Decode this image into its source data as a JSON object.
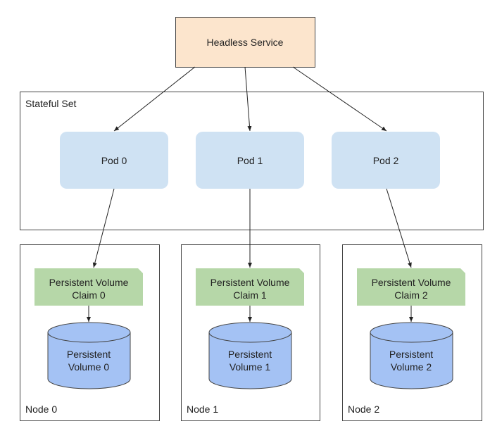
{
  "service": {
    "label": "Headless Service",
    "color": "#fce5cd"
  },
  "statefulset": {
    "label": "Stateful Set"
  },
  "pods": [
    {
      "label": "Pod 0"
    },
    {
      "label": "Pod 1"
    },
    {
      "label": "Pod 2"
    }
  ],
  "nodes": [
    {
      "label": "Node 0",
      "pvc_line1": "Persistent Volume",
      "pvc_line2": "Claim 0",
      "pv_line1": "Persistent",
      "pv_line2": "Volume 0"
    },
    {
      "label": "Node 1",
      "pvc_line1": "Persistent Volume",
      "pvc_line2": "Claim 1",
      "pv_line1": "Persistent",
      "pv_line2": "Volume 1"
    },
    {
      "label": "Node 2",
      "pvc_line1": "Persistent Volume",
      "pvc_line2": "Claim 2",
      "pv_line1": "Persistent",
      "pv_line2": "Volume 2"
    }
  ],
  "colors": {
    "pod": "#cfe2f3",
    "pvc": "#b6d7a8",
    "pv": "#a4c2f4"
  }
}
